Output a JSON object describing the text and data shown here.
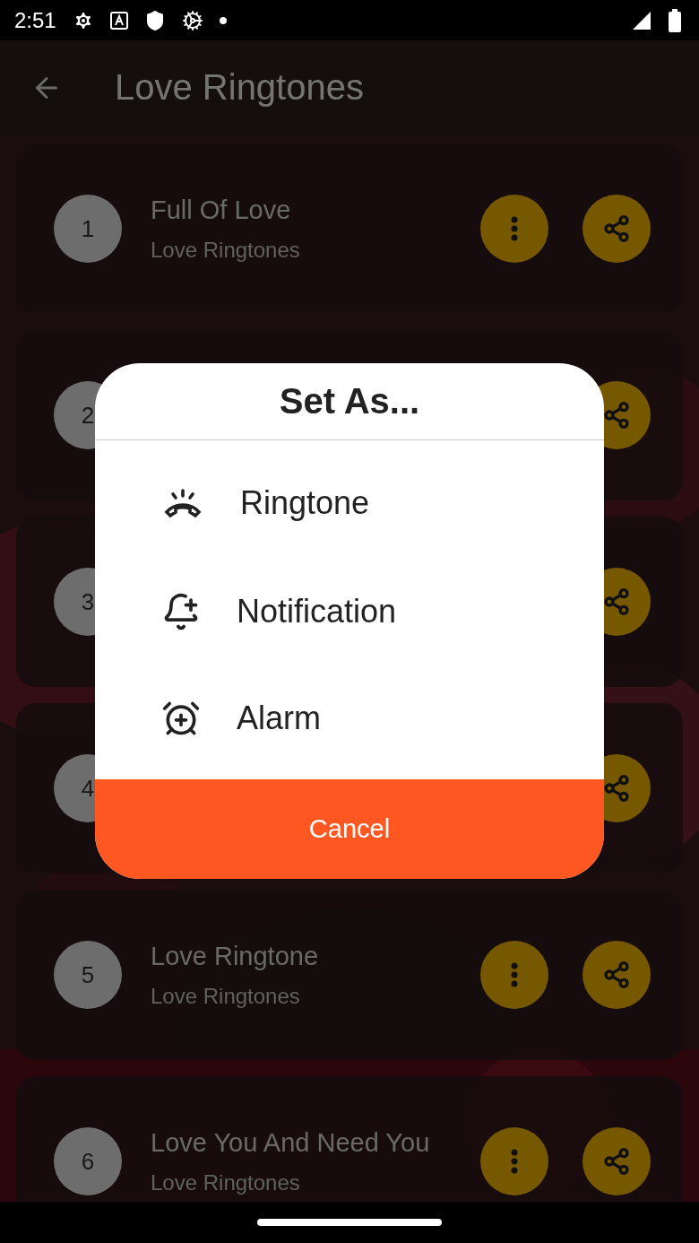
{
  "status_bar": {
    "time": "2:51"
  },
  "app_bar": {
    "title": "Love Ringtones"
  },
  "rows": [
    {
      "number": "1",
      "title": "Full Of Love",
      "subtitle": "Love Ringtones"
    },
    {
      "number": "2"
    },
    {
      "number": "3"
    },
    {
      "number": "4"
    },
    {
      "number": "5",
      "title": "Love Ringtone",
      "subtitle": "Love Ringtones"
    },
    {
      "number": "6",
      "title": "Love You And Need You",
      "subtitle": "Love Ringtones"
    }
  ],
  "dialog": {
    "title": "Set As...",
    "options": [
      {
        "kind": "ringtone",
        "label": "Ringtone"
      },
      {
        "kind": "notification",
        "label": "Notification"
      },
      {
        "kind": "alarm",
        "label": "Alarm"
      }
    ],
    "cancel": "Cancel"
  }
}
